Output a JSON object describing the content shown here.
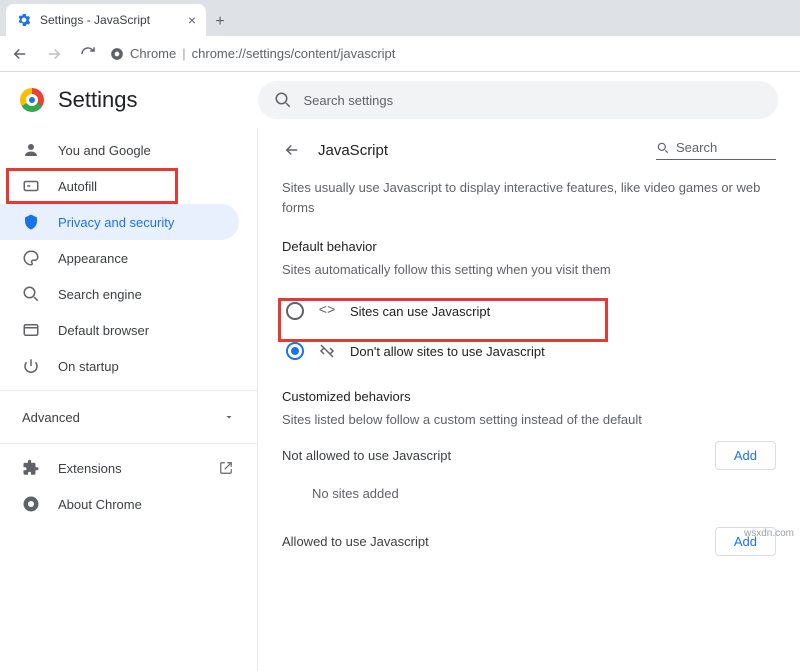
{
  "browser": {
    "tab_title": "Settings - JavaScript",
    "omnibox_scheme": "Chrome",
    "omnibox_path": "chrome://settings/content/javascript"
  },
  "header": {
    "app_title": "Settings",
    "search_placeholder": "Search settings"
  },
  "sidebar": {
    "items": [
      {
        "label": "You and Google"
      },
      {
        "label": "Autofill"
      },
      {
        "label": "Privacy and security"
      },
      {
        "label": "Appearance"
      },
      {
        "label": "Search engine"
      },
      {
        "label": "Default browser"
      },
      {
        "label": "On startup"
      }
    ],
    "advanced_label": "Advanced",
    "extensions_label": "Extensions",
    "about_label": "About Chrome"
  },
  "panel": {
    "title": "JavaScript",
    "search_placeholder": "Search",
    "description": "Sites usually use Javascript to display interactive features, like video games or web forms",
    "default_behavior_title": "Default behavior",
    "default_behavior_sub": "Sites automatically follow this setting when you visit them",
    "option_allow": "Sites can use Javascript",
    "option_block": "Don't allow sites to use Javascript",
    "custom_title": "Customized behaviors",
    "custom_sub": "Sites listed below follow a custom setting instead of the default",
    "not_allowed_label": "Not allowed to use Javascript",
    "allowed_label": "Allowed to use Javascript",
    "add_label": "Add",
    "no_sites": "No sites added"
  },
  "watermark": "wsxdn.com"
}
